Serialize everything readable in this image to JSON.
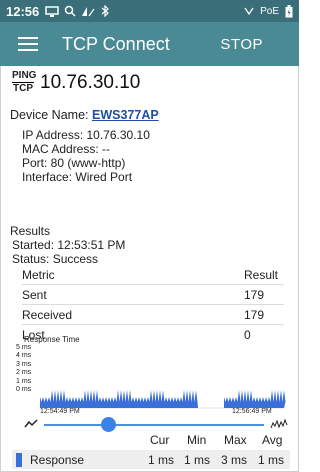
{
  "status_bar": {
    "time": "12:56",
    "icons": [
      "display-icon",
      "search-icon",
      "signal-icon",
      "bluetooth-icon"
    ],
    "right_icons": [
      "ethernet-icon",
      "poe-icon",
      "battery-icon"
    ],
    "poe_label": "PoE"
  },
  "app_bar": {
    "title": "TCP Connect",
    "stop_label": "STOP"
  },
  "ping_tcp": {
    "top": "PING",
    "bottom": "TCP"
  },
  "target_ip": "10.76.30.10",
  "device": {
    "label": "Device Name:",
    "name": "EWS377AP"
  },
  "info": {
    "ip": "IP Address: 10.76.30.10",
    "mac": "MAC Address: --",
    "port": "Port: 80 (www-http)",
    "interface": "Interface: Wired Port"
  },
  "results": {
    "title": "Results",
    "started": "Started: 12:53:51 PM",
    "status": "Status: Success"
  },
  "metrics": {
    "col_metric": "Metric",
    "col_result": "Result",
    "rows": [
      {
        "name": "Sent",
        "value": "179"
      },
      {
        "name": "Received",
        "value": "179"
      },
      {
        "name": "Lost",
        "value": "0"
      }
    ]
  },
  "graph": {
    "title": "Response Time",
    "y_labels": [
      "5 ms",
      "4 ms",
      "3 ms",
      "2 ms",
      "1 ms",
      "0 ms"
    ],
    "time_start": "12:54:49 PM",
    "time_end": "12:56:49 PM",
    "slider_position": 0.29,
    "series_color": "#3a6ed8"
  },
  "stats": {
    "headers": [
      "Cur",
      "Min",
      "Max",
      "Avg"
    ],
    "legend_name": "Response",
    "values": [
      "1 ms",
      "1 ms",
      "3 ms",
      "1 ms"
    ]
  }
}
